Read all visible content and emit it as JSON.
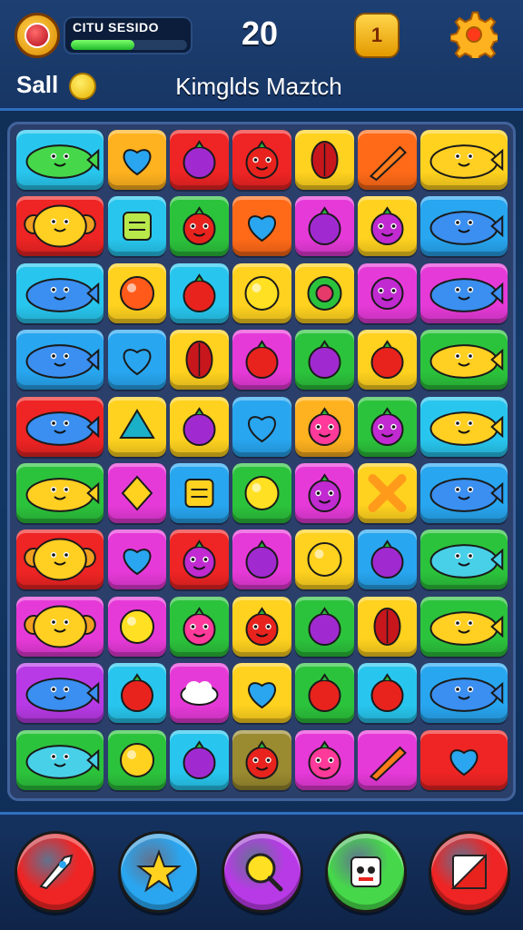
{
  "hud": {
    "level_label": "CITU SESIDO",
    "progress": 0.55,
    "score": "20",
    "coins_label": "Sall",
    "title": "Kimglds Maztch",
    "goal_glyph": "1",
    "avatar_icon": "avatar-badge-icon",
    "goal_icon": "goal-badge-icon",
    "settings_icon": "gear-icon",
    "coin_icon": "coin-icon"
  },
  "board": {
    "columns": 7,
    "rows": 10,
    "tiles": [
      [
        "frog",
        "heart",
        "berry",
        "strawberry",
        "leaf",
        "carrot",
        "fish"
      ],
      [
        "monkey",
        "box",
        "strawberry",
        "heart",
        "berry",
        "blob",
        "whale"
      ],
      [
        "whale",
        "swirl",
        "apple",
        "ball",
        "ring",
        "flower",
        "whale"
      ],
      [
        "whale",
        "heart",
        "leaf",
        "apple",
        "berry",
        "apple",
        "fish"
      ],
      [
        "whale",
        "gem",
        "berry",
        "heart",
        "cat",
        "blob",
        "fish"
      ],
      [
        "fish",
        "diamond",
        "note",
        "ball",
        "blob",
        "cross",
        "whale"
      ],
      [
        "monkey",
        "heart",
        "blob",
        "berry",
        "lemon",
        "berry",
        "dolphin"
      ],
      [
        "monkey",
        "ball",
        "cat",
        "strawberry",
        "berry",
        "leaf",
        "fish"
      ],
      [
        "whale",
        "apple",
        "cloud",
        "heart",
        "apple",
        "apple",
        "whale"
      ],
      [
        "dolphin",
        "lemon",
        "berry",
        "strawberry",
        "cat",
        "carrot",
        "heart"
      ]
    ],
    "colors": [
      [
        "#28c6ee",
        "#ffb21f",
        "#ef2424",
        "#ef2424",
        "#ffd21f",
        "#ff6a18",
        "#ffd21f"
      ],
      [
        "#ef2424",
        "#28c6ee",
        "#2cc33c",
        "#ff6a18",
        "#e63ad8",
        "#ffd21f",
        "#28a6f0"
      ],
      [
        "#28c6ee",
        "#ffd21f",
        "#28c6ee",
        "#ffd21f",
        "#ffd21f",
        "#e63ad8",
        "#e63ad8"
      ],
      [
        "#28a6f0",
        "#28a6f0",
        "#ffd21f",
        "#e63ad8",
        "#2cc33c",
        "#ffd21f",
        "#2cc33c"
      ],
      [
        "#ef2424",
        "#ffd21f",
        "#ffd21f",
        "#28a6f0",
        "#ffb21f",
        "#2cc33c",
        "#28c6ee"
      ],
      [
        "#2cc33c",
        "#e63ad8",
        "#28a6f0",
        "#2cc33c",
        "#e63ad8",
        "#ffd21f",
        "#28a6f0"
      ],
      [
        "#ef2424",
        "#e63ad8",
        "#ef2424",
        "#e63ad8",
        "#ffd21f",
        "#28a6f0",
        "#2cc33c"
      ],
      [
        "#e63ad8",
        "#e63ad8",
        "#2cc33c",
        "#ffd21f",
        "#2cc33c",
        "#ffd21f",
        "#2cc33c"
      ],
      [
        "#b83ae6",
        "#28c6ee",
        "#e63ad8",
        "#ffd21f",
        "#2cc33c",
        "#28c6ee",
        "#28a6f0"
      ],
      [
        "#2cc33c",
        "#2cc33c",
        "#28c6ee",
        "#9a8a30",
        "#e63ad8",
        "#e63ad8",
        "#ef2424"
      ]
    ],
    "piece_colors": {
      "frog": "#46d84a",
      "heart": "#2aa6f0",
      "berry": "#a02ad0",
      "strawberry": "#e8231d",
      "leaf": "#c8161d",
      "carrot": "#ff7a1a",
      "fish": "#ffcf22",
      "monkey": "#ffcf22",
      "box": "#b9e84a",
      "whale": "#3a8ff0",
      "swirl": "#ff5a1a",
      "apple": "#e8231d",
      "ball": "#ffe022",
      "ring": "#e63a6a",
      "flower": "#c02ad0",
      "gem": "#1ab0c8",
      "cat": "#ff3a9a",
      "blob": "#c02ad0",
      "diamond": "#ffd21f",
      "note": "#ffd21f",
      "cross": "#ff9a1a",
      "lemon": "#ffd21f",
      "dolphin": "#48d0e8",
      "cloud": "#ffffff"
    }
  },
  "powerups": [
    {
      "name": "rocket",
      "color": "#ef2424",
      "icon": "rocket-icon"
    },
    {
      "name": "star",
      "color": "#2aa6f0",
      "icon": "star-icon"
    },
    {
      "name": "magnifier",
      "color": "#b83ae6",
      "icon": "magnifier-icon"
    },
    {
      "name": "robot",
      "color": "#46d84a",
      "icon": "robot-icon"
    },
    {
      "name": "shuffle",
      "color": "#ef2424",
      "icon": "shuffle-icon"
    }
  ]
}
